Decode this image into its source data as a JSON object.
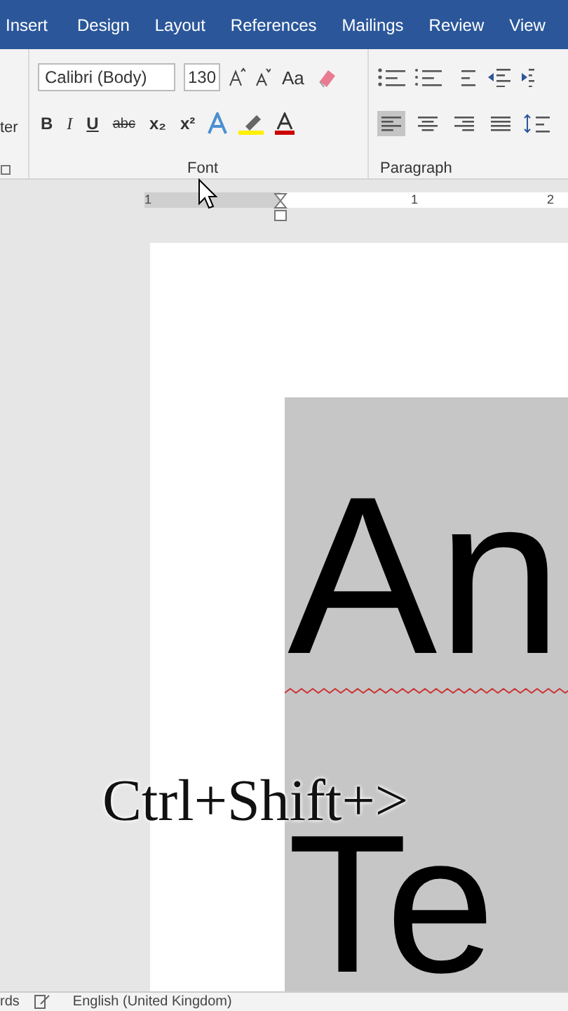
{
  "tabs": [
    {
      "label": "Insert",
      "selected": false
    },
    {
      "label": "Design",
      "selected": false
    },
    {
      "label": "Layout",
      "selected": false
    },
    {
      "label": "References",
      "selected": false
    },
    {
      "label": "Mailings",
      "selected": false
    },
    {
      "label": "Review",
      "selected": false
    },
    {
      "label": "View",
      "selected": false
    }
  ],
  "ribbon": {
    "clipboard_label": "ter",
    "font_name": "Calibri (Body)",
    "font_size": "130",
    "case_button": "Aa",
    "format_buttons": [
      {
        "label": "B",
        "kind": "bold"
      },
      {
        "label": "I",
        "kind": "italic"
      },
      {
        "label": "U",
        "kind": "underline"
      },
      {
        "label": "abc",
        "kind": "strike"
      },
      {
        "label": "x₂",
        "kind": "sub"
      },
      {
        "label": "x²",
        "kind": "sup"
      }
    ],
    "alignment": [
      {
        "kind": "left",
        "selected": true
      },
      {
        "kind": "center",
        "selected": false
      },
      {
        "kind": "right",
        "selected": false
      },
      {
        "kind": "justify",
        "selected": false
      }
    ],
    "groups": [
      "Font",
      "Paragraph"
    ]
  },
  "ruler": {
    "labels": [
      "1",
      "1",
      "2"
    ]
  },
  "document": {
    "lines": [
      "An",
      "Te"
    ],
    "spelling_error": true
  },
  "overlay_caption": "Ctrl+Shift+>",
  "status_bar": {
    "words": "rds",
    "language": "English (United Kingdom)"
  }
}
